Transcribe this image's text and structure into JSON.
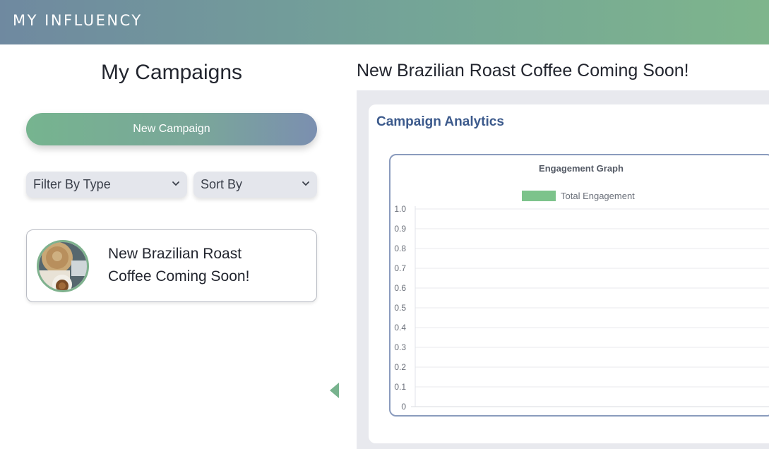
{
  "app": {
    "brand": "MY INFLUENCY"
  },
  "left": {
    "title": "My Campaigns",
    "new_campaign_label": "New Campaign",
    "filter_select": {
      "selected": "Filter By Type"
    },
    "sort_select": {
      "selected": "Sort By"
    },
    "campaigns": [
      {
        "title": "New Brazilian Roast Coffee Coming Soon!"
      }
    ]
  },
  "right": {
    "title": "New Brazilian Roast Coffee Coming Soon!",
    "analytics_title": "Campaign Analytics"
  },
  "colors": {
    "brand_gradient_start": "#6f89a0",
    "brand_gradient_end": "#7eb58c",
    "accent_green": "#76b48f",
    "analytics_title": "#3c5a8c",
    "legend_green": "#7cc38b"
  },
  "icons": {
    "select_arrow": "chevron-down-icon",
    "collapse": "triangle-left-icon"
  },
  "chart_data": {
    "type": "bar",
    "title": "Engagement Graph",
    "legend_position": "top",
    "series": [
      {
        "name": "Total Engagement",
        "color": "#7cc38b",
        "values": []
      }
    ],
    "categories": [],
    "ylim": [
      0,
      1.0
    ],
    "yticks": [
      "1.0",
      "0.9",
      "0.8",
      "0.7",
      "0.6",
      "0.5",
      "0.4",
      "0.3",
      "0.2",
      "0.1",
      "0"
    ],
    "grid": true
  }
}
